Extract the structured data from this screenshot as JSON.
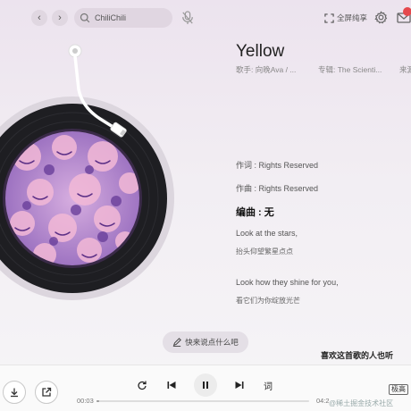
{
  "nav": {
    "back_icon": "chevron-left-icon",
    "forward_icon": "chevron-right-icon"
  },
  "search": {
    "value": "ChiliChili",
    "icon": "search-icon"
  },
  "header": {
    "fullscreen_label": "全屏纯享"
  },
  "song": {
    "title": "Yellow",
    "singer": "歌手: 向晚Ava / ...",
    "album": "专辑: The Scienti...",
    "source": "来源"
  },
  "lyrics": [
    {
      "text": "作词 : Rights Reserved",
      "style": "normal"
    },
    {
      "text": "作曲 : Rights Reserved",
      "style": "normal"
    },
    {
      "text": "编曲 : 无",
      "style": "active"
    },
    {
      "text": "Look at the stars,",
      "style": "normal"
    },
    {
      "text": "抬头仰望繁星点点",
      "style": "trans"
    },
    {
      "text": "Look how they shine for you,",
      "style": "normal"
    },
    {
      "text": "看它们为你绽放光芒",
      "style": "trans"
    }
  ],
  "comment": {
    "label": "快来说点什么吧"
  },
  "likes_text": "喜欢这首歌的人也听",
  "player": {
    "current_time": "00:03",
    "duration": "04:2",
    "progress": 0.012,
    "lyric_label": "词",
    "quality": "极高"
  },
  "watermark": "@稀土掘金技术社区",
  "colors": {
    "accent": "#e5484d",
    "disc": "#1e1e22",
    "artwork": "#b58bd6"
  }
}
